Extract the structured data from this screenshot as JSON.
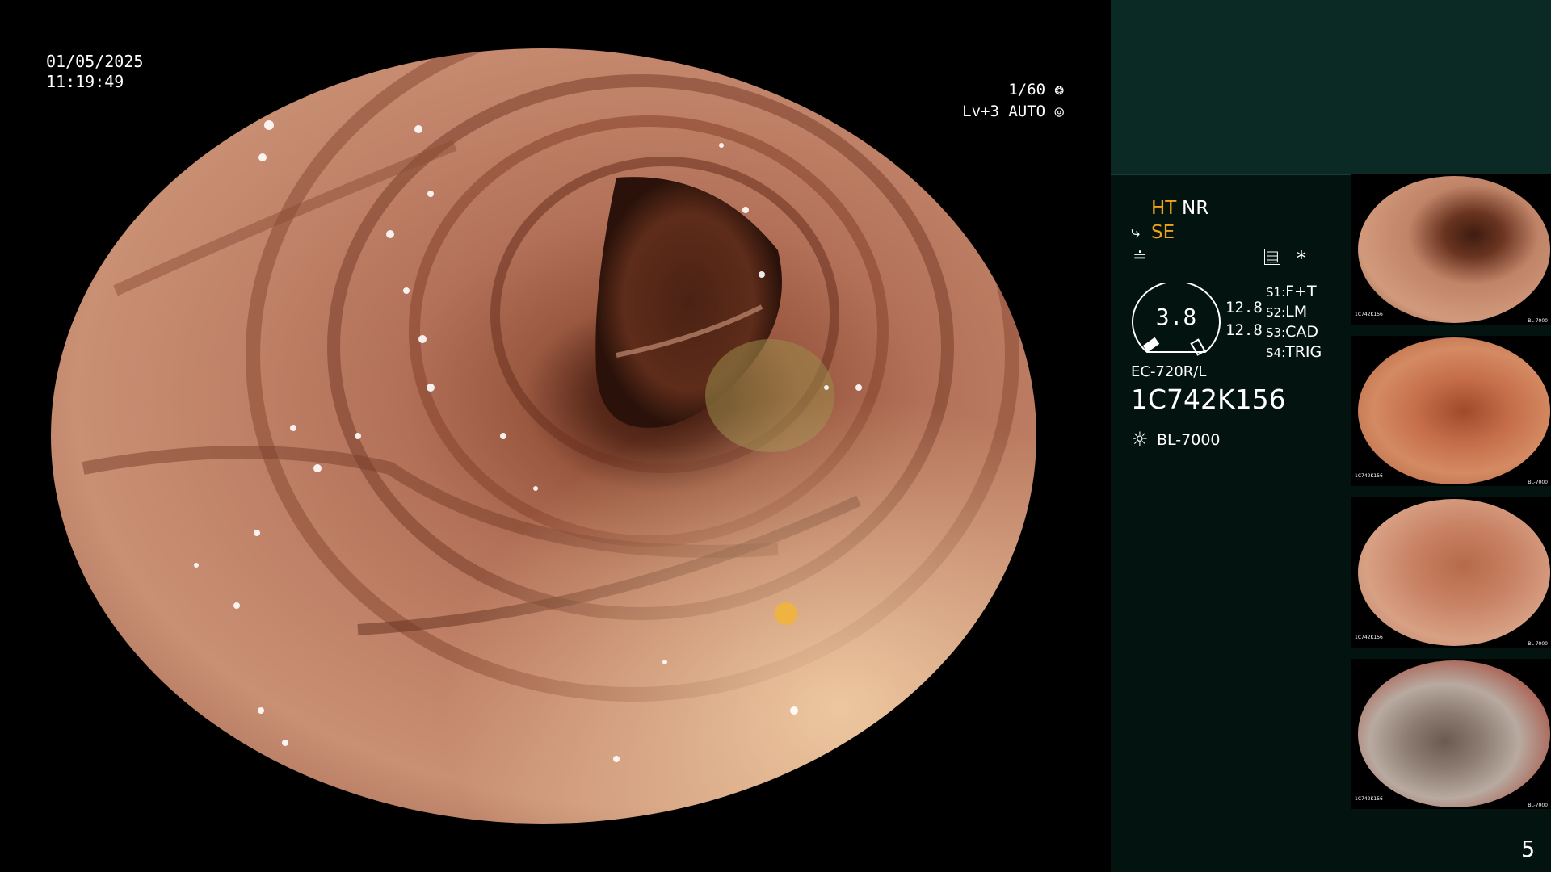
{
  "overlay": {
    "date": "01/05/2025",
    "time": "11:19:49",
    "shutter": "1/60",
    "level": "Lv+3 AUTO"
  },
  "panel": {
    "ht": "HT",
    "nr": "NR",
    "se": "SE",
    "gauge_value": "3.8",
    "gauge_right_1": "12.8",
    "gauge_right_2": "12.8",
    "switches": [
      {
        "key": "S1:",
        "value": "F+T"
      },
      {
        "key": "S2:",
        "value": "LM"
      },
      {
        "key": "S3:",
        "value": "CAD"
      },
      {
        "key": "S4:",
        "value": "TRIG"
      }
    ],
    "asterisk": "*",
    "scope_model": "EC-720R/L",
    "serial": "1C742K156",
    "light_source": "BL-7000"
  },
  "thumbnails": [
    {
      "caption": "1C742K156",
      "footer": "BL-7000"
    },
    {
      "caption": "1C742K156",
      "footer": "BL-7000"
    },
    {
      "caption": "1C742K156",
      "footer": "BL-7000"
    },
    {
      "caption": "1C742K156",
      "footer": "BL-7000"
    }
  ],
  "page_number": "5",
  "colors": {
    "panel_bg": "#031410",
    "panel_top_bg": "#0b2a26",
    "accent_orange": "#f2a11a"
  }
}
